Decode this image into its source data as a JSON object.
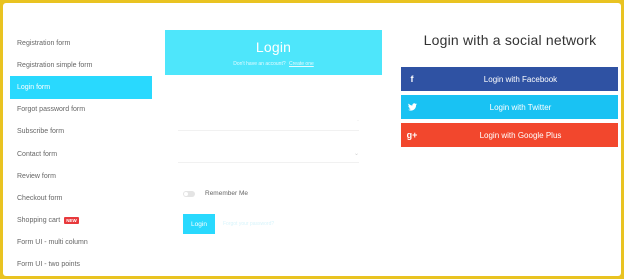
{
  "sidebar": {
    "items": [
      {
        "label": "Registration form",
        "active": false
      },
      {
        "label": "Registration simple form",
        "active": false
      },
      {
        "label": "Login form",
        "active": true
      },
      {
        "label": "Forgot password form",
        "active": false
      },
      {
        "label": "Subscribe form",
        "active": false
      },
      {
        "label": "Contact form",
        "active": false
      },
      {
        "label": "Review form",
        "active": false
      },
      {
        "label": "Checkout form",
        "active": false
      },
      {
        "label": "Shopping cart",
        "active": false,
        "badge": "NEW"
      },
      {
        "label": "Form UI - multi column",
        "active": false
      },
      {
        "label": "Form UI - two points",
        "active": false
      }
    ]
  },
  "login": {
    "title": "Login",
    "subtitle": "Don't have an account?",
    "subtitle_link": "Create one",
    "field1_value": "",
    "field2_value": "",
    "remember_label": "Remember Me",
    "button_label": "Login",
    "forgot_link": "Forgot your password?"
  },
  "social": {
    "title": "Login with a social network",
    "buttons": [
      {
        "label": "Login with Facebook",
        "icon": "f",
        "color": "#2f52a3"
      },
      {
        "label": "Login with Twitter",
        "icon": "twitter-bird",
        "color": "#19c2f3"
      },
      {
        "label": "Login with Google Plus",
        "icon": "g+",
        "color": "#f2472d"
      }
    ]
  },
  "colors": {
    "accent": "#29d9fe",
    "header": "#4ee6fb",
    "frame": "#e9c321"
  }
}
